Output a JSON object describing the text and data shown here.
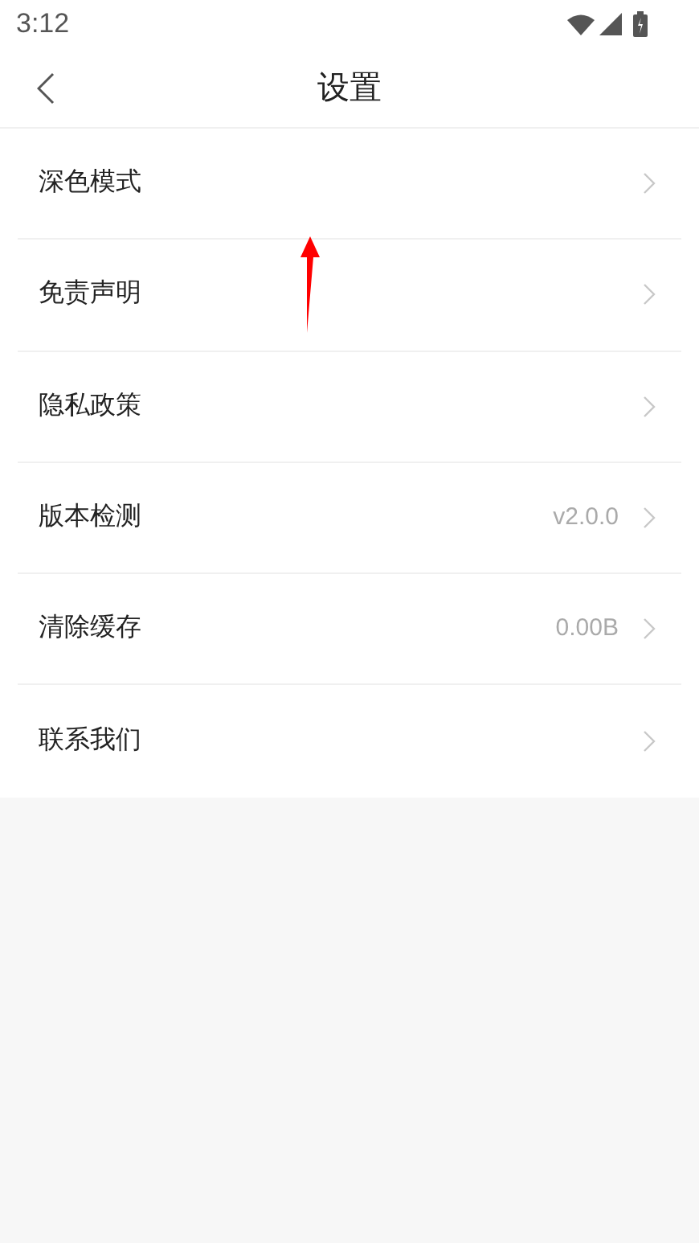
{
  "status_bar": {
    "time": "3:12"
  },
  "header": {
    "title": "设置"
  },
  "settings": [
    {
      "label": "深色模式"
    },
    {
      "label": "免责声明"
    },
    {
      "label": "隐私政策"
    },
    {
      "label": "版本检测",
      "value": "v2.0.0"
    },
    {
      "label": "清除缓存",
      "value": "0.00B"
    },
    {
      "label": "联系我们"
    }
  ]
}
